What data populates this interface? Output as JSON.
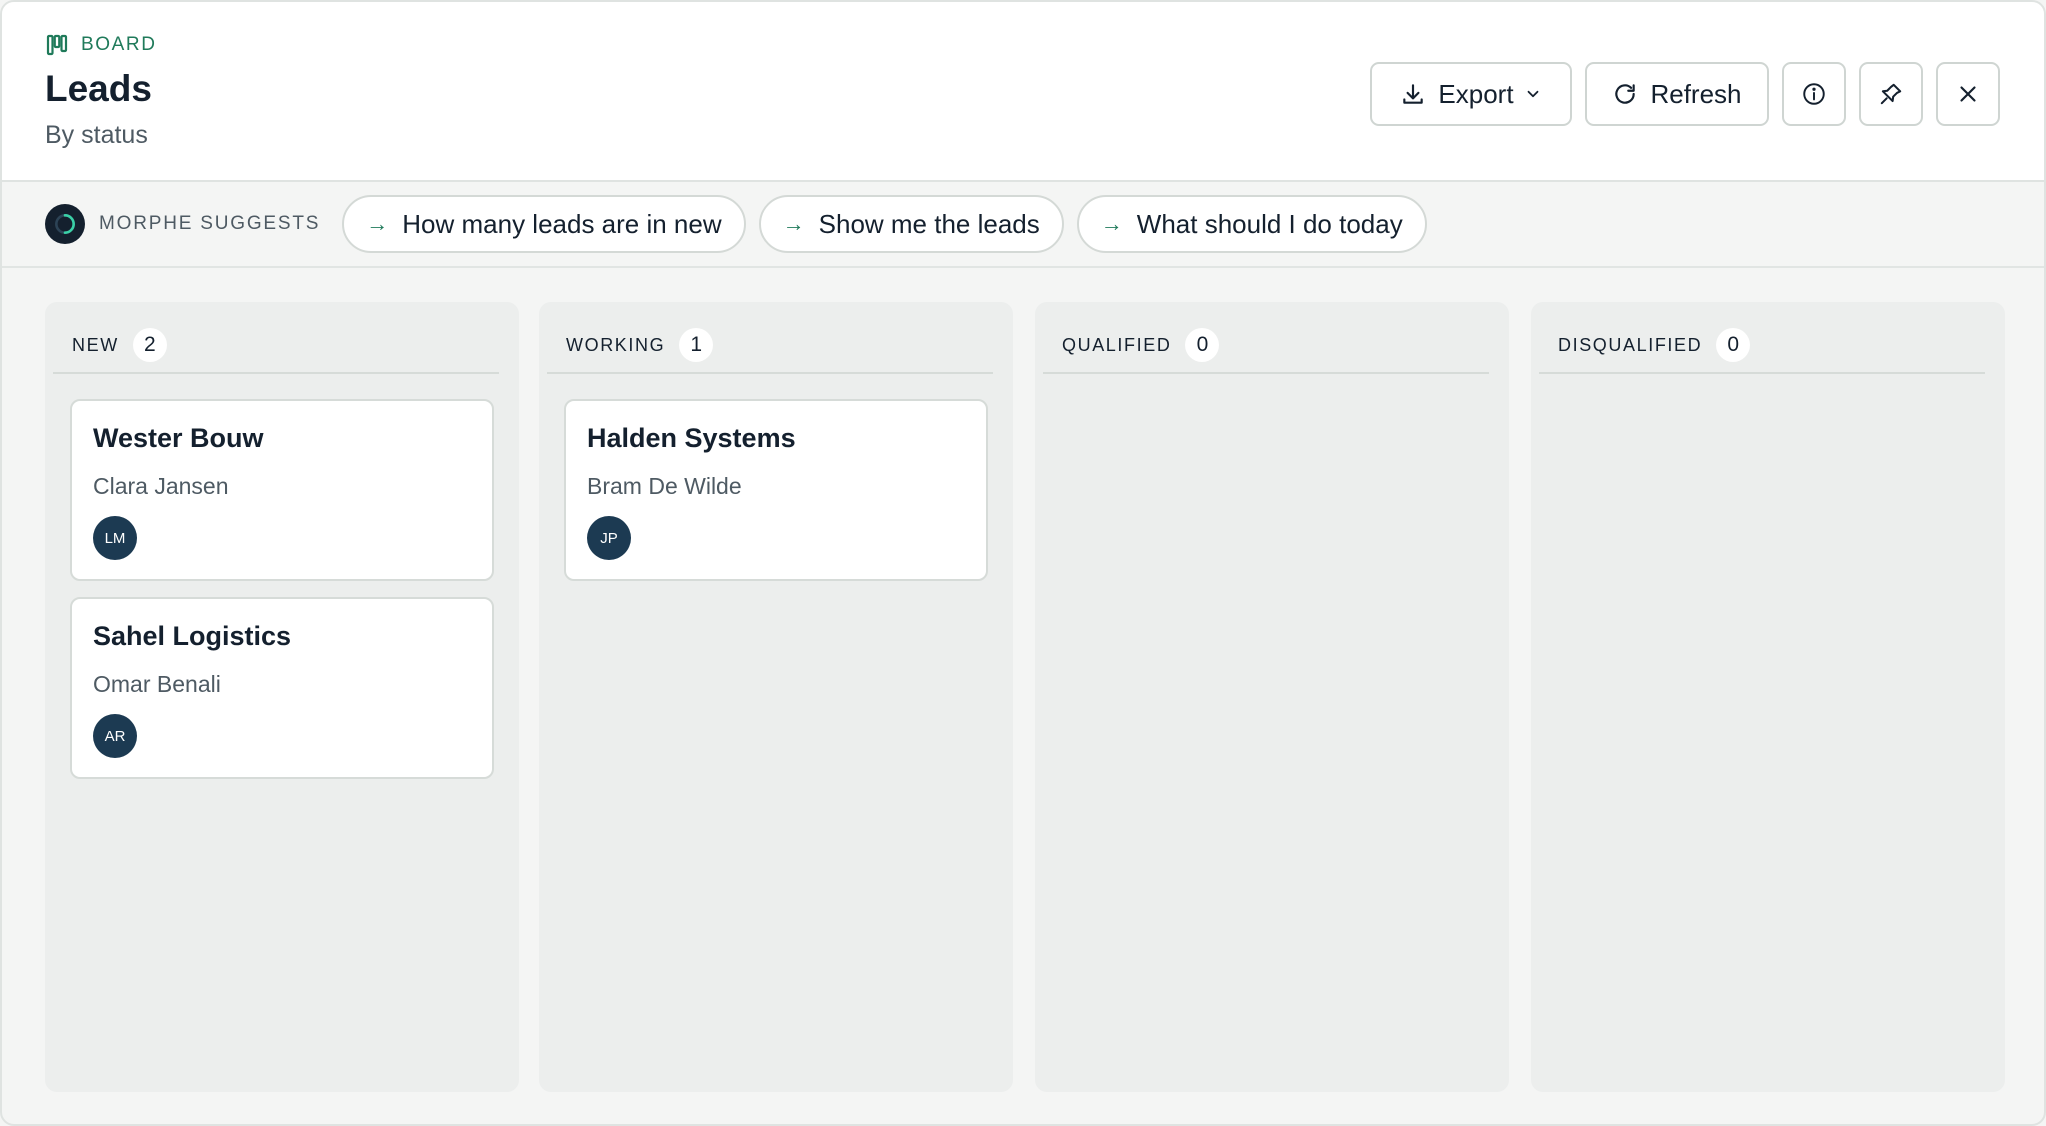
{
  "header": {
    "eyebrow": "BOARD",
    "title": "Leads",
    "subtitle": "By status",
    "actions": {
      "export_label": "Export",
      "refresh_label": "Refresh"
    }
  },
  "suggestions": {
    "label": "MORPHE SUGGESTS",
    "chips": [
      {
        "arrow": "→",
        "label": "How many leads are in new"
      },
      {
        "arrow": "→",
        "label": "Show me the leads"
      },
      {
        "arrow": "→",
        "label": "What should I do today"
      }
    ]
  },
  "columns": [
    {
      "name": "NEW",
      "count": "2",
      "cards": [
        {
          "title": "Wester Bouw",
          "contact": "Clara Jansen",
          "owner": "LM"
        },
        {
          "title": "Sahel Logistics",
          "contact": "Omar Benali",
          "owner": "AR"
        }
      ]
    },
    {
      "name": "WORKING",
      "count": "1",
      "cards": [
        {
          "title": "Halden Systems",
          "contact": "Bram De Wilde",
          "owner": "JP"
        }
      ]
    },
    {
      "name": "QUALIFIED",
      "count": "0",
      "cards": []
    },
    {
      "name": "DISQUALIFIED",
      "count": "0",
      "cards": []
    }
  ],
  "colors": {
    "accent": "#1f7a5a",
    "avatar": "#1c3a52",
    "text": "#14202e"
  },
  "icons": [
    "board-icon",
    "download-icon",
    "chevron-down-icon",
    "refresh-icon",
    "info-icon",
    "pin-icon",
    "close-icon",
    "morphe-logo-icon",
    "arrow-right-icon"
  ]
}
